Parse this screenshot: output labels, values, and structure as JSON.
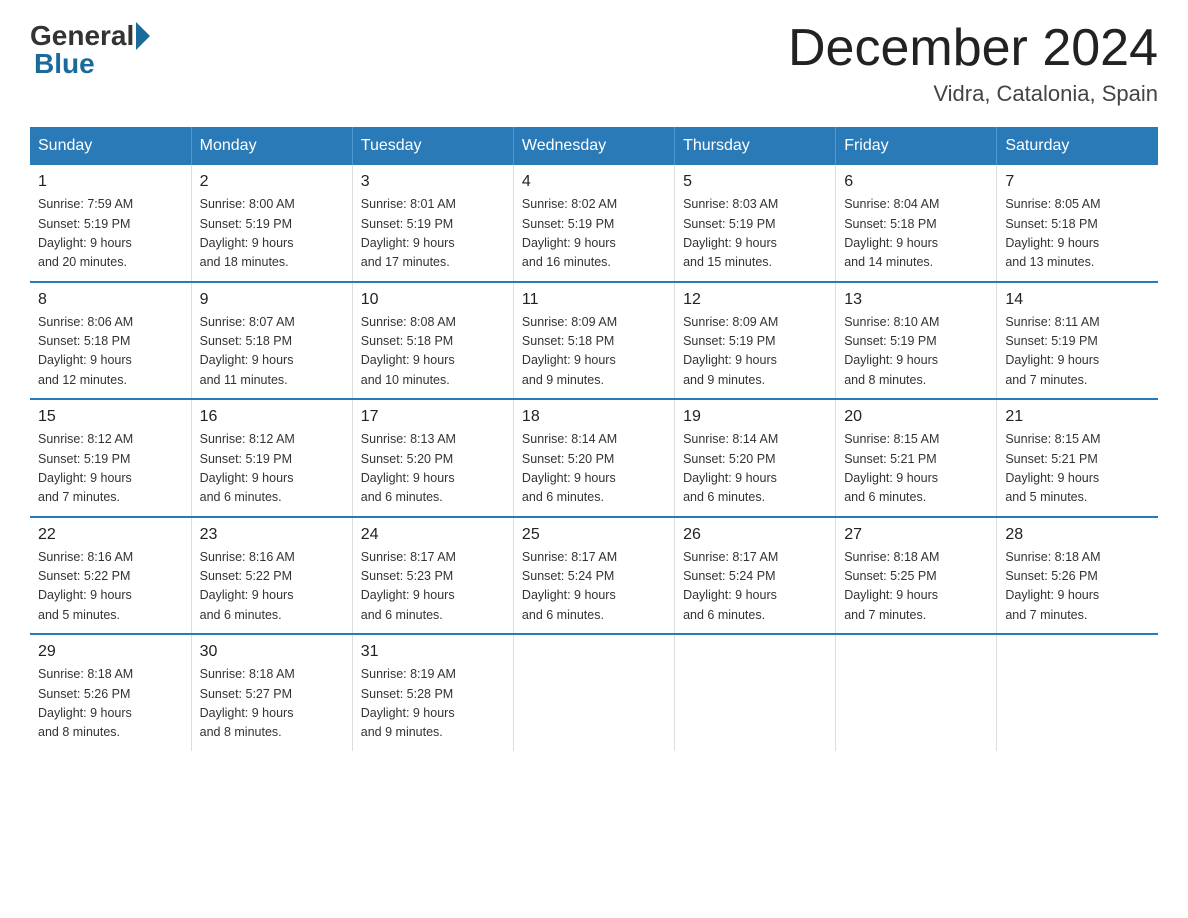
{
  "logo": {
    "general": "General",
    "blue": "Blue"
  },
  "title": "December 2024",
  "subtitle": "Vidra, Catalonia, Spain",
  "weekdays": [
    "Sunday",
    "Monday",
    "Tuesday",
    "Wednesday",
    "Thursday",
    "Friday",
    "Saturday"
  ],
  "weeks": [
    [
      {
        "day": "1",
        "sunrise": "7:59 AM",
        "sunset": "5:19 PM",
        "daylight": "9 hours and 20 minutes."
      },
      {
        "day": "2",
        "sunrise": "8:00 AM",
        "sunset": "5:19 PM",
        "daylight": "9 hours and 18 minutes."
      },
      {
        "day": "3",
        "sunrise": "8:01 AM",
        "sunset": "5:19 PM",
        "daylight": "9 hours and 17 minutes."
      },
      {
        "day": "4",
        "sunrise": "8:02 AM",
        "sunset": "5:19 PM",
        "daylight": "9 hours and 16 minutes."
      },
      {
        "day": "5",
        "sunrise": "8:03 AM",
        "sunset": "5:19 PM",
        "daylight": "9 hours and 15 minutes."
      },
      {
        "day": "6",
        "sunrise": "8:04 AM",
        "sunset": "5:18 PM",
        "daylight": "9 hours and 14 minutes."
      },
      {
        "day": "7",
        "sunrise": "8:05 AM",
        "sunset": "5:18 PM",
        "daylight": "9 hours and 13 minutes."
      }
    ],
    [
      {
        "day": "8",
        "sunrise": "8:06 AM",
        "sunset": "5:18 PM",
        "daylight": "9 hours and 12 minutes."
      },
      {
        "day": "9",
        "sunrise": "8:07 AM",
        "sunset": "5:18 PM",
        "daylight": "9 hours and 11 minutes."
      },
      {
        "day": "10",
        "sunrise": "8:08 AM",
        "sunset": "5:18 PM",
        "daylight": "9 hours and 10 minutes."
      },
      {
        "day": "11",
        "sunrise": "8:09 AM",
        "sunset": "5:18 PM",
        "daylight": "9 hours and 9 minutes."
      },
      {
        "day": "12",
        "sunrise": "8:09 AM",
        "sunset": "5:19 PM",
        "daylight": "9 hours and 9 minutes."
      },
      {
        "day": "13",
        "sunrise": "8:10 AM",
        "sunset": "5:19 PM",
        "daylight": "9 hours and 8 minutes."
      },
      {
        "day": "14",
        "sunrise": "8:11 AM",
        "sunset": "5:19 PM",
        "daylight": "9 hours and 7 minutes."
      }
    ],
    [
      {
        "day": "15",
        "sunrise": "8:12 AM",
        "sunset": "5:19 PM",
        "daylight": "9 hours and 7 minutes."
      },
      {
        "day": "16",
        "sunrise": "8:12 AM",
        "sunset": "5:19 PM",
        "daylight": "9 hours and 6 minutes."
      },
      {
        "day": "17",
        "sunrise": "8:13 AM",
        "sunset": "5:20 PM",
        "daylight": "9 hours and 6 minutes."
      },
      {
        "day": "18",
        "sunrise": "8:14 AM",
        "sunset": "5:20 PM",
        "daylight": "9 hours and 6 minutes."
      },
      {
        "day": "19",
        "sunrise": "8:14 AM",
        "sunset": "5:20 PM",
        "daylight": "9 hours and 6 minutes."
      },
      {
        "day": "20",
        "sunrise": "8:15 AM",
        "sunset": "5:21 PM",
        "daylight": "9 hours and 6 minutes."
      },
      {
        "day": "21",
        "sunrise": "8:15 AM",
        "sunset": "5:21 PM",
        "daylight": "9 hours and 5 minutes."
      }
    ],
    [
      {
        "day": "22",
        "sunrise": "8:16 AM",
        "sunset": "5:22 PM",
        "daylight": "9 hours and 5 minutes."
      },
      {
        "day": "23",
        "sunrise": "8:16 AM",
        "sunset": "5:22 PM",
        "daylight": "9 hours and 6 minutes."
      },
      {
        "day": "24",
        "sunrise": "8:17 AM",
        "sunset": "5:23 PM",
        "daylight": "9 hours and 6 minutes."
      },
      {
        "day": "25",
        "sunrise": "8:17 AM",
        "sunset": "5:24 PM",
        "daylight": "9 hours and 6 minutes."
      },
      {
        "day": "26",
        "sunrise": "8:17 AM",
        "sunset": "5:24 PM",
        "daylight": "9 hours and 6 minutes."
      },
      {
        "day": "27",
        "sunrise": "8:18 AM",
        "sunset": "5:25 PM",
        "daylight": "9 hours and 7 minutes."
      },
      {
        "day": "28",
        "sunrise": "8:18 AM",
        "sunset": "5:26 PM",
        "daylight": "9 hours and 7 minutes."
      }
    ],
    [
      {
        "day": "29",
        "sunrise": "8:18 AM",
        "sunset": "5:26 PM",
        "daylight": "9 hours and 8 minutes."
      },
      {
        "day": "30",
        "sunrise": "8:18 AM",
        "sunset": "5:27 PM",
        "daylight": "9 hours and 8 minutes."
      },
      {
        "day": "31",
        "sunrise": "8:19 AM",
        "sunset": "5:28 PM",
        "daylight": "9 hours and 9 minutes."
      },
      null,
      null,
      null,
      null
    ]
  ],
  "labels": {
    "sunrise": "Sunrise:",
    "sunset": "Sunset:",
    "daylight": "Daylight:"
  }
}
